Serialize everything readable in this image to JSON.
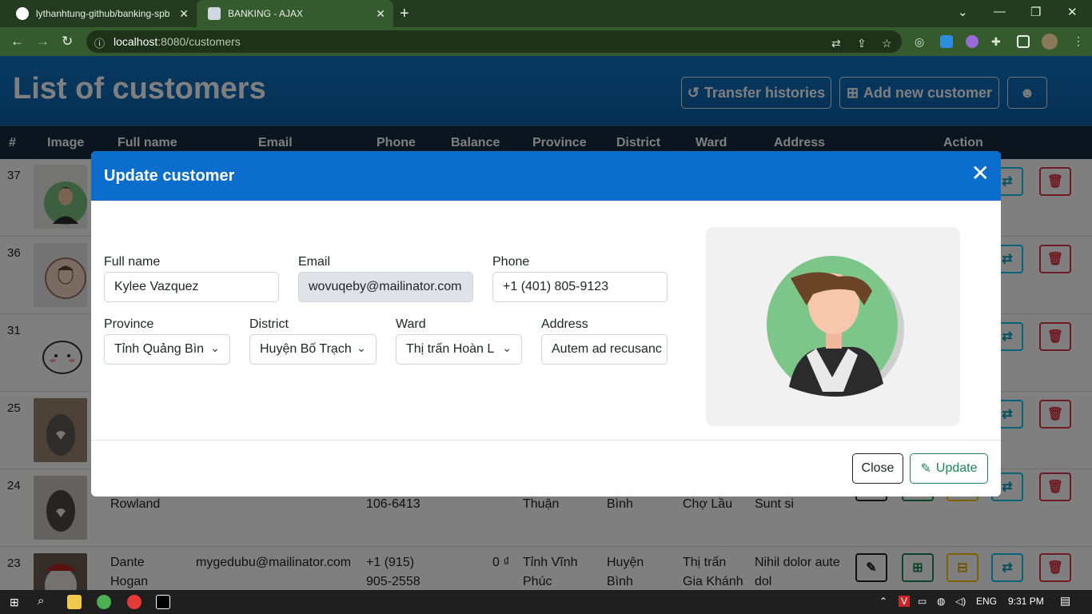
{
  "browser": {
    "tabs": [
      {
        "title": "lythanhtung-github/banking-spb",
        "close": "✕"
      },
      {
        "title": "BANKING - AJAX",
        "close": "✕"
      }
    ],
    "new_tab": "+",
    "controls": {
      "dropdown": "⌄",
      "minimize": "—",
      "restore": "❐",
      "close": "✕"
    },
    "nav": {
      "back": "←",
      "forward": "→",
      "reload": "↻"
    },
    "url_host": "localhost",
    "url_rest": ":8080/customers",
    "info_icon": "ⓘ"
  },
  "page": {
    "title": "List of customers",
    "buttons": {
      "transfer_histories": "Transfer histories",
      "add_new_customer": "Add new customer"
    },
    "table": {
      "headers": [
        "#",
        "Image",
        "Full name",
        "Email",
        "Phone",
        "Balance",
        "Province",
        "District",
        "Ward",
        "Address",
        "Action"
      ],
      "rows": [
        {
          "id": "37"
        },
        {
          "id": "36"
        },
        {
          "id": "31"
        },
        {
          "id": "25"
        },
        {
          "id": "24",
          "name": "Rowland",
          "phone": "106-6413",
          "province": "Thuận",
          "district": "Bình",
          "ward": "Chợ Lầu",
          "address": "Sunt si"
        },
        {
          "id": "23",
          "name_1": "Dante",
          "name_2": "Hogan",
          "email": "mygedubu@mailinator.com",
          "phone_1": "+1 (915)",
          "phone_2": "905-2558",
          "balance": "0 ₫",
          "province_1": "Tỉnh Vĩnh",
          "province_2": "Phúc",
          "district_1": "Huyện",
          "district_2": "Bình",
          "ward_1": "Thị trấn",
          "ward_2": "Gia Khánh",
          "address_1": "Nihil dolor aute",
          "address_2": "dol"
        }
      ]
    }
  },
  "modal": {
    "title": "Update customer",
    "close_icon": "✕",
    "fields": {
      "full_name": {
        "label": "Full name",
        "value": "Kylee Vazquez"
      },
      "email": {
        "label": "Email",
        "value": "wovuqeby@mailinator.com"
      },
      "phone": {
        "label": "Phone",
        "value": "+1 (401) 805-9123"
      },
      "province": {
        "label": "Province",
        "value": "Tỉnh Quảng Bìn"
      },
      "district": {
        "label": "District",
        "value": "Huyện Bố Trạch"
      },
      "ward": {
        "label": "Ward",
        "value": "Thị trấn Hoàn L"
      },
      "address": {
        "label": "Address",
        "value": "Autem ad recusanc"
      }
    },
    "buttons": {
      "close": "Close",
      "update": "Update"
    }
  },
  "taskbar": {
    "language": "ENG",
    "time": "9:31 PM"
  },
  "colors": {
    "header_blue": "#0f74c4",
    "modal_header": "#0b6dcc",
    "table_head": "#162a3e",
    "success": "#198754",
    "danger": "#dc3545",
    "info": "#0dcaf0",
    "warning": "#ffc107"
  }
}
